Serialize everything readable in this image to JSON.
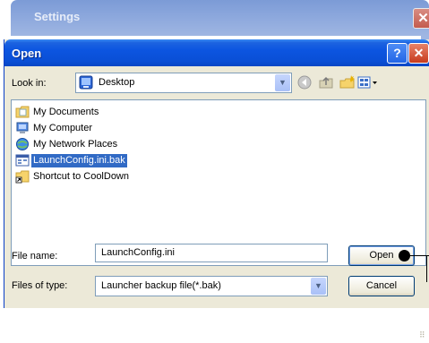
{
  "background_window": {
    "title": "Settings",
    "close_glyph": "✕"
  },
  "dialog": {
    "title": "Open",
    "help_glyph": "?",
    "close_glyph": "✕",
    "look_in": {
      "label": "Look in:",
      "value": "Desktop",
      "icon": "desktop-icon"
    },
    "toolbar_icons": [
      "back-icon",
      "up-folder-icon",
      "new-folder-icon",
      "views-menu-icon"
    ],
    "files": [
      {
        "name": "My Documents",
        "icon": "my-documents-icon",
        "selected": false
      },
      {
        "name": "My Computer",
        "icon": "my-computer-icon",
        "selected": false
      },
      {
        "name": "My Network Places",
        "icon": "network-places-icon",
        "selected": false
      },
      {
        "name": "LaunchConfig.ini.bak",
        "icon": "config-file-icon",
        "selected": true
      },
      {
        "name": "Shortcut to CoolDown",
        "icon": "shortcut-folder-icon",
        "selected": false
      }
    ],
    "file_name": {
      "label": "File name:",
      "value": "LaunchConfig.ini"
    },
    "file_type": {
      "label": "Files of type:",
      "value": "Launcher backup file(*.bak)"
    },
    "buttons": {
      "open": "Open",
      "cancel": "Cancel"
    }
  },
  "colors": {
    "title_bar": "#0a4fd6",
    "dialog_face": "#ece9d8",
    "selection": "#316ac5",
    "input_border": "#7f9db9"
  }
}
